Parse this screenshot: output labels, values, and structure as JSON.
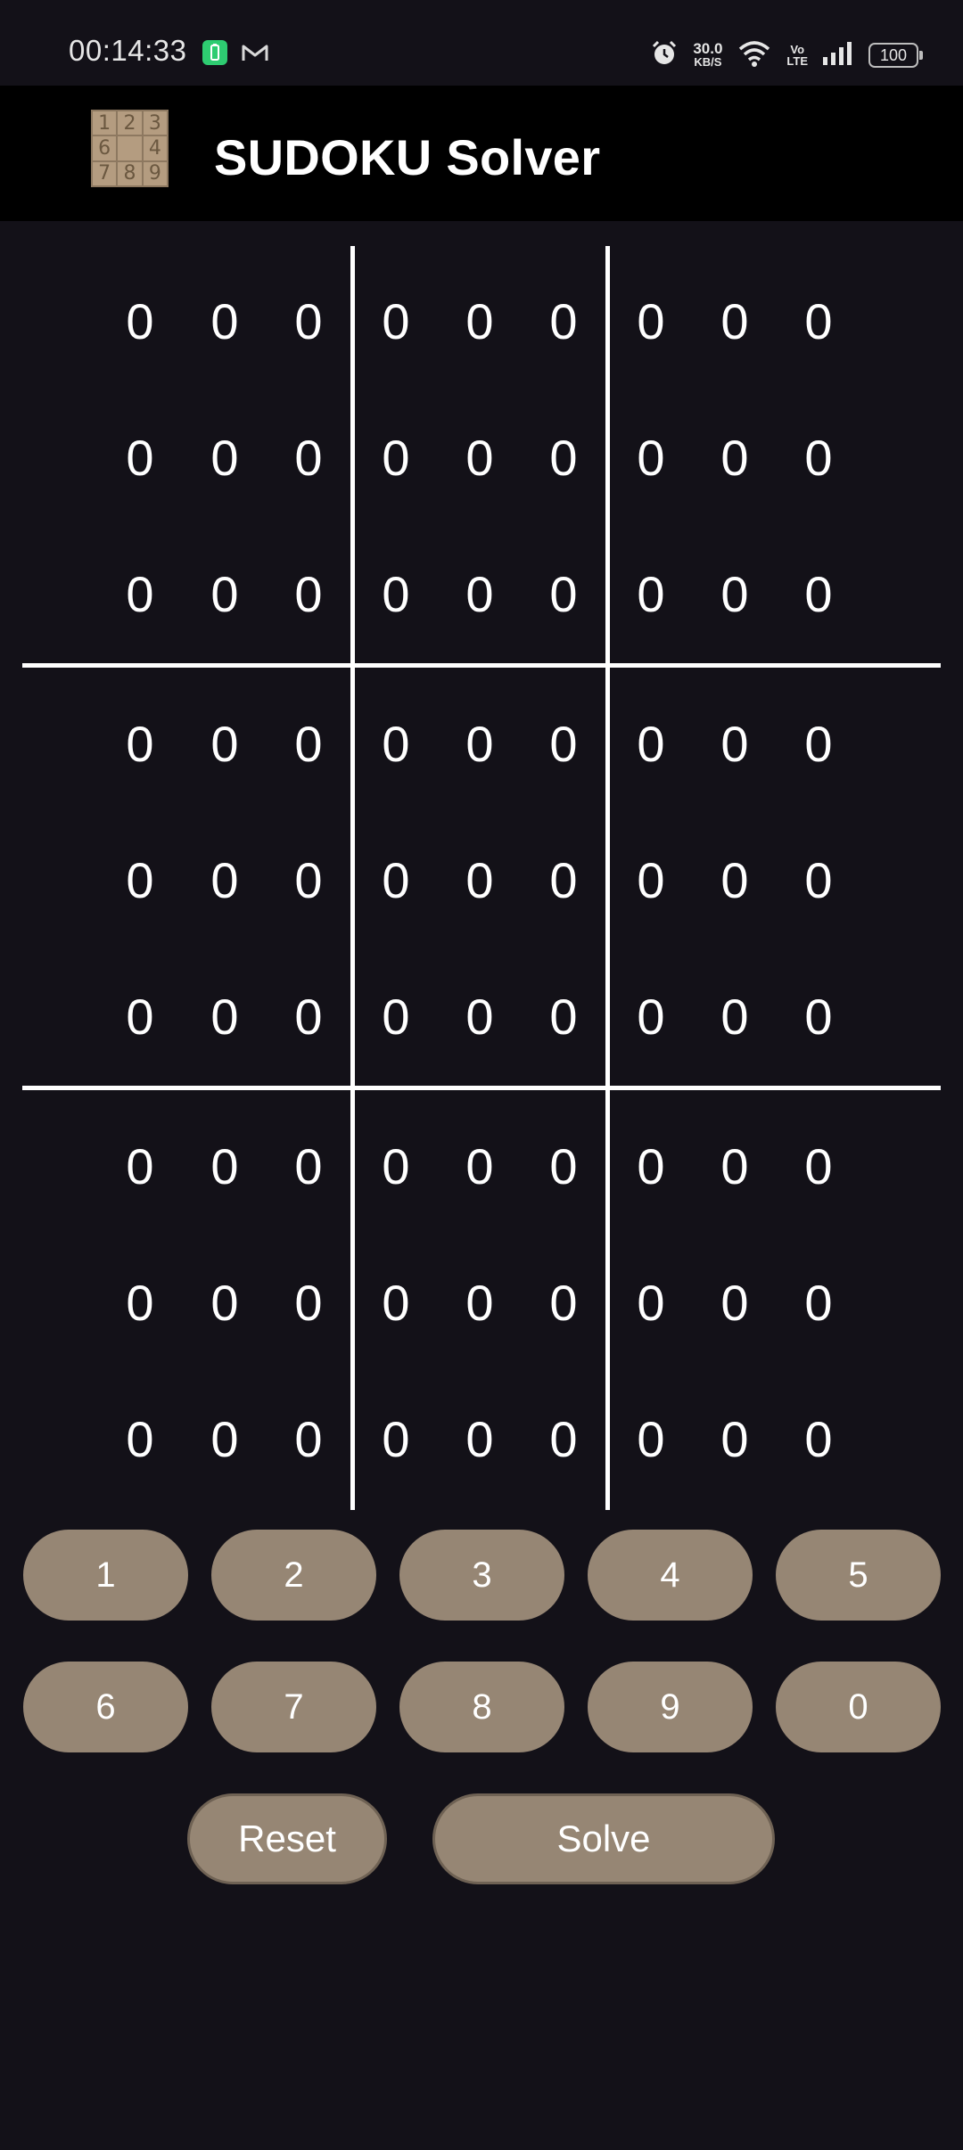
{
  "status_bar": {
    "time": "00:14:33",
    "network_speed_value": "30.0",
    "network_speed_unit": "KB/S",
    "volte_top": "Vo",
    "volte_bottom": "LTE",
    "battery": "100",
    "icons": [
      "battery-saver-icon",
      "gmail-icon",
      "alarm-icon",
      "wifi-icon",
      "signal-icon"
    ]
  },
  "app_bar": {
    "title": "SUDOKU Solver",
    "logo_digits": [
      "1",
      "2",
      "3",
      "6",
      "",
      "4",
      "7",
      "8",
      "9"
    ]
  },
  "grid": {
    "rows": [
      [
        "0",
        "0",
        "0",
        "0",
        "0",
        "0",
        "0",
        "0",
        "0"
      ],
      [
        "0",
        "0",
        "0",
        "0",
        "0",
        "0",
        "0",
        "0",
        "0"
      ],
      [
        "0",
        "0",
        "0",
        "0",
        "0",
        "0",
        "0",
        "0",
        "0"
      ],
      [
        "0",
        "0",
        "0",
        "0",
        "0",
        "0",
        "0",
        "0",
        "0"
      ],
      [
        "0",
        "0",
        "0",
        "0",
        "0",
        "0",
        "0",
        "0",
        "0"
      ],
      [
        "0",
        "0",
        "0",
        "0",
        "0",
        "0",
        "0",
        "0",
        "0"
      ],
      [
        "0",
        "0",
        "0",
        "0",
        "0",
        "0",
        "0",
        "0",
        "0"
      ],
      [
        "0",
        "0",
        "0",
        "0",
        "0",
        "0",
        "0",
        "0",
        "0"
      ],
      [
        "0",
        "0",
        "0",
        "0",
        "0",
        "0",
        "0",
        "0",
        "0"
      ]
    ]
  },
  "keypad": {
    "keys": [
      "1",
      "2",
      "3",
      "4",
      "5",
      "6",
      "7",
      "8",
      "9",
      "0"
    ]
  },
  "actions": {
    "reset_label": "Reset",
    "solve_label": "Solve"
  },
  "colors": {
    "background": "#131118",
    "app_bar": "#000000",
    "button": "#968674",
    "grid_lines": "#ffffff"
  }
}
